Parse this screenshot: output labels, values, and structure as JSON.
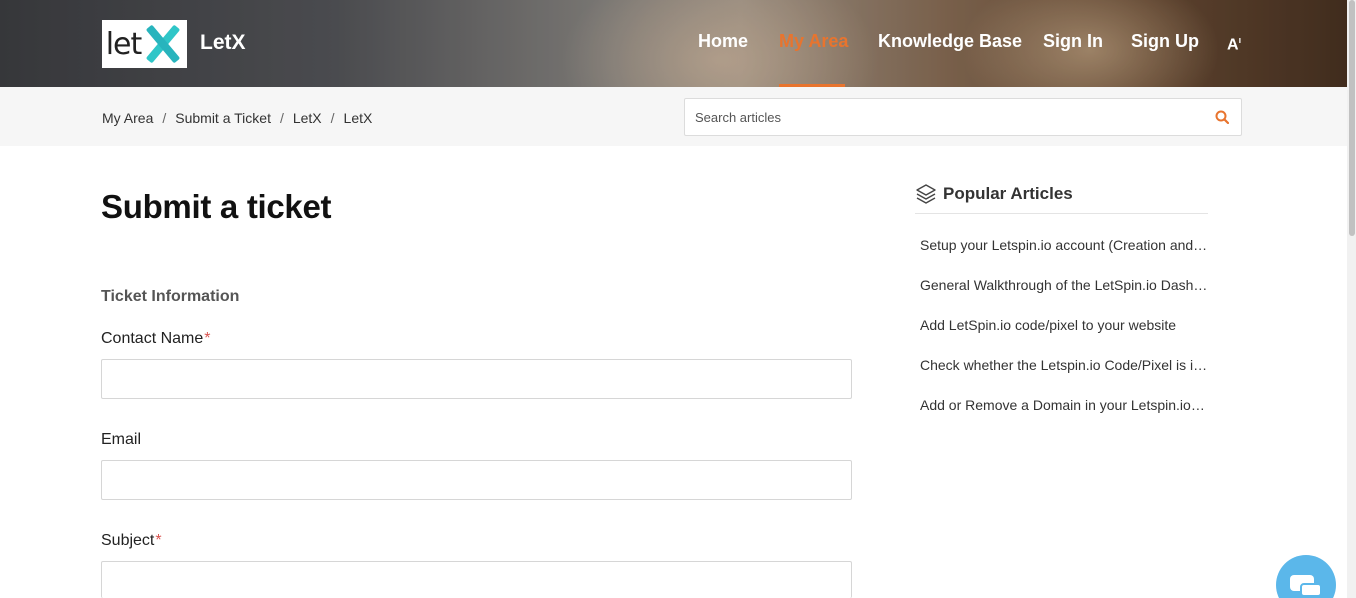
{
  "header": {
    "logo_text": "let",
    "brand": "LetX",
    "nav": [
      {
        "label": "Home"
      },
      {
        "label": "My Area"
      },
      {
        "label": "Knowledge Base"
      },
      {
        "label": "Sign In"
      },
      {
        "label": "Sign Up"
      }
    ],
    "font_size_icon": "A"
  },
  "breadcrumb": {
    "items": [
      "My Area",
      "Submit a Ticket",
      "LetX",
      "LetX"
    ]
  },
  "search": {
    "placeholder": "Search articles"
  },
  "form": {
    "title": "Submit a ticket",
    "section": "Ticket Information",
    "fields": [
      {
        "label": "Contact Name",
        "required": "*"
      },
      {
        "label": "Email"
      },
      {
        "label": "Subject",
        "required": "*"
      }
    ]
  },
  "sidebar": {
    "title": "Popular Articles",
    "articles": [
      "Setup your Letspin.io account (Creation and Setup)",
      "General Walkthrough of the LetSpin.io Dashboard",
      "Add LetSpin.io code/pixel to your website",
      "Check whether the Letspin.io Code/Pixel is installed",
      "Add or Remove a Domain in your Letspin.io account"
    ]
  },
  "colors": {
    "accent": "#e8742e",
    "logo_teal": "#2fc6c8",
    "chat": "#5bb7ea"
  }
}
